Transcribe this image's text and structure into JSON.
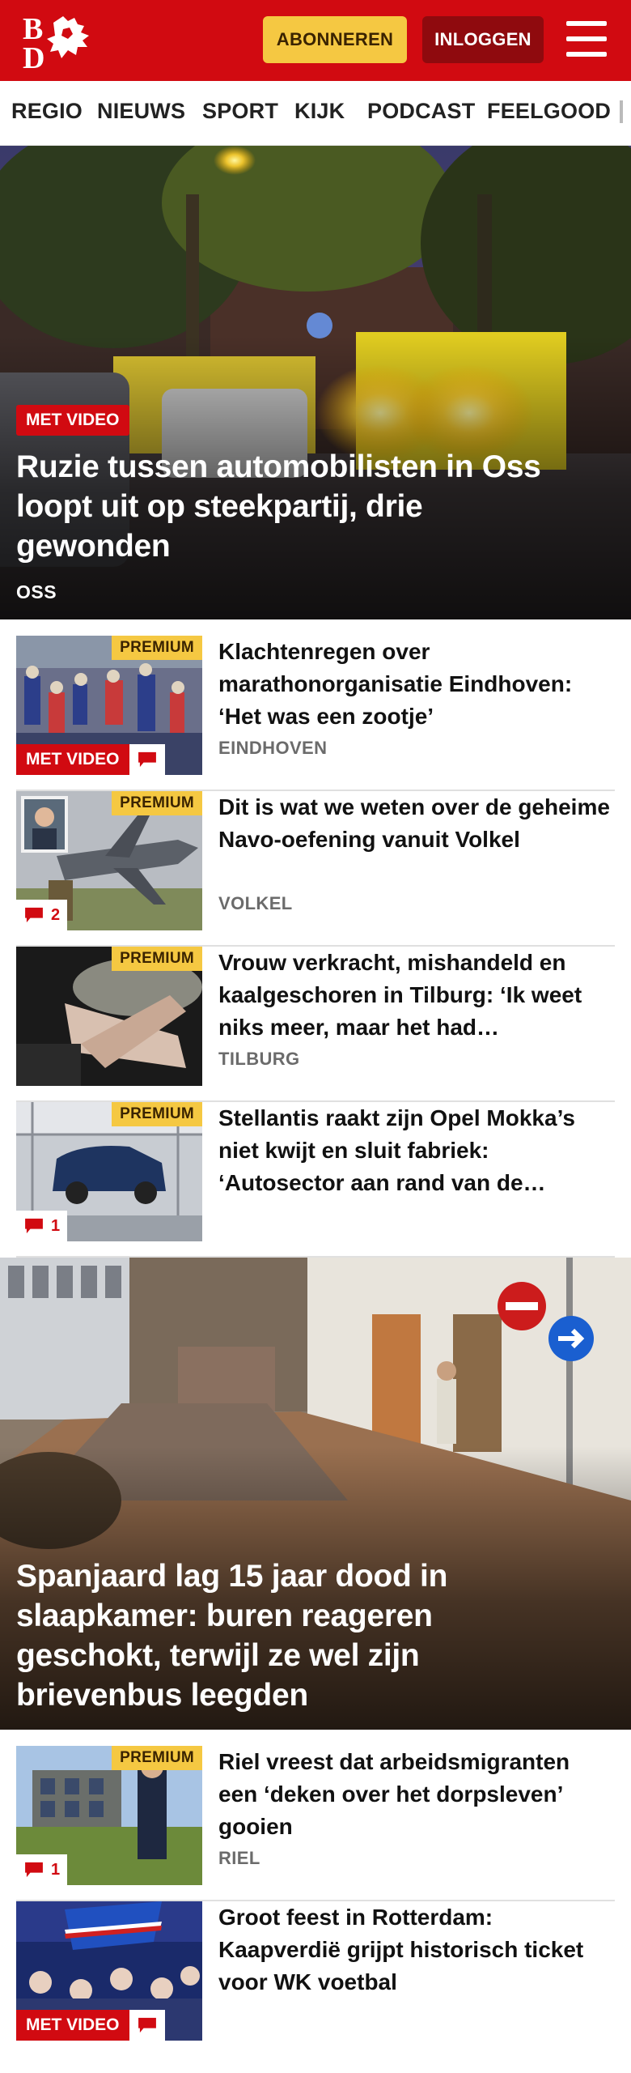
{
  "header": {
    "logo_text": "BD",
    "subscribe_label": "ABONNEREN",
    "login_label": "INLOGGEN",
    "brand_color": "#d10a11",
    "subscribe_color": "#f5c842"
  },
  "nav": {
    "items": [
      "REGIO",
      "NIEUWS",
      "SPORT",
      "KIJK",
      "PODCAST",
      "FEELGOOD"
    ]
  },
  "hero1": {
    "badge": "MET VIDEO",
    "title": "Ruzie tussen automobilisten in Oss loopt uit op steekpartij, drie gewonden",
    "location": "OSS"
  },
  "list1": [
    {
      "premium": "PREMIUM",
      "video": "MET VIDEO",
      "comments": "",
      "title": "Klachtenregen over marathonorganisatie Eindhoven: ‘Het was een zootje’",
      "location": "EINDHOVEN"
    },
    {
      "premium": "PREMIUM",
      "video": "",
      "comments": "2",
      "title": "Dit is wat we weten over de geheime Navo-oefening vanuit Volkel",
      "location": "VOLKEL"
    },
    {
      "premium": "PREMIUM",
      "video": "",
      "comments": "",
      "title": "Vrouw verkracht, mishandeld en kaalgeschoren in Tilburg: ‘Ik weet niks meer, maar het had…",
      "location": "TILBURG"
    },
    {
      "premium": "PREMIUM",
      "video": "",
      "comments": "1",
      "title": "Stellantis raakt zijn Opel Mokka’s niet kwijt en sluit fabriek: ‘Autosector aan rand van de…",
      "location": ""
    }
  ],
  "hero2": {
    "title": "Spanjaard lag 15 jaar dood in slaapkamer: buren reageren geschokt, terwijl ze wel zijn brievenbus leegden"
  },
  "list2": [
    {
      "premium": "PREMIUM",
      "video": "",
      "comments": "1",
      "title": "Riel vreest dat arbeidsmigranten een ‘deken over het dorpsleven’ gooien",
      "location": "RIEL"
    },
    {
      "premium": "",
      "video": "MET VIDEO",
      "comments": "",
      "title": "Groot feest in Rotterdam: Kaapverdië grijpt historisch ticket voor WK voetbal",
      "location": ""
    }
  ]
}
